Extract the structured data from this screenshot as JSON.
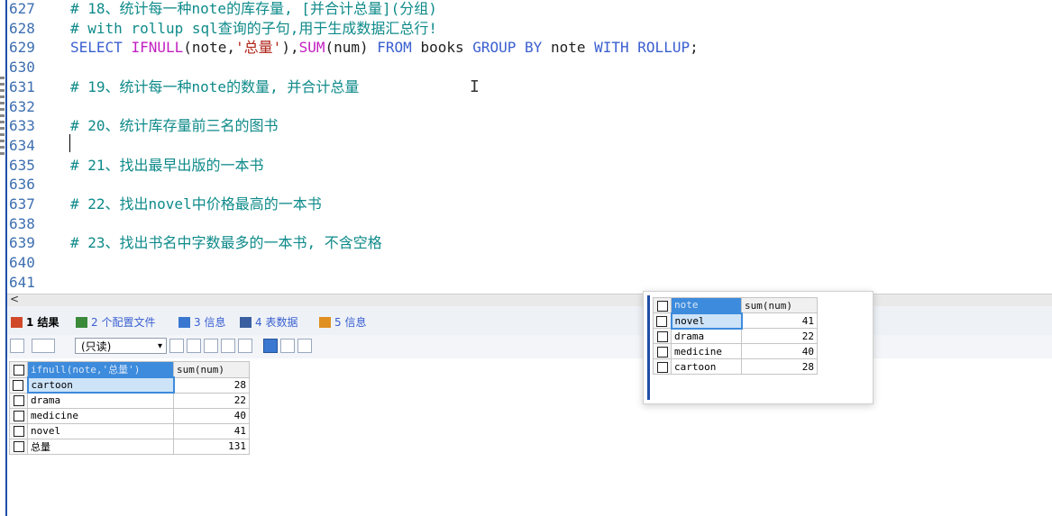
{
  "editor": {
    "lines": [
      {
        "num": "627",
        "parts": [
          {
            "t": "# 18、统计每一种note的库存量, [并合计总量](分组)",
            "c": "cm"
          }
        ]
      },
      {
        "num": "628",
        "parts": [
          {
            "t": "# with rollup sql查询的子句,用于生成数据汇总行!",
            "c": "cm"
          }
        ]
      },
      {
        "num": "629",
        "parts": [
          {
            "t": "SELECT ",
            "c": "kw"
          },
          {
            "t": "IFNULL",
            "c": "fn"
          },
          {
            "t": "(note,",
            "c": "pl"
          },
          {
            "t": "'总量'",
            "c": "str"
          },
          {
            "t": "),",
            "c": "pl"
          },
          {
            "t": "SUM",
            "c": "fn"
          },
          {
            "t": "(num) ",
            "c": "pl"
          },
          {
            "t": "FROM ",
            "c": "kw"
          },
          {
            "t": "books ",
            "c": "pl"
          },
          {
            "t": "GROUP BY ",
            "c": "kw"
          },
          {
            "t": "note ",
            "c": "pl"
          },
          {
            "t": "WITH ROLLUP",
            "c": "kw"
          },
          {
            "t": ";",
            "c": "pl"
          }
        ]
      },
      {
        "num": "630",
        "parts": []
      },
      {
        "num": "631",
        "parts": [
          {
            "t": "# 19、统计每一种note的数量, 并合计总量",
            "c": "cm"
          }
        ]
      },
      {
        "num": "632",
        "parts": []
      },
      {
        "num": "633",
        "parts": [
          {
            "t": "# 20、统计库存量前三名的图书",
            "c": "cm"
          }
        ]
      },
      {
        "num": "634",
        "parts": []
      },
      {
        "num": "635",
        "parts": [
          {
            "t": "# 21、找出最早出版的一本书",
            "c": "cm"
          }
        ]
      },
      {
        "num": "636",
        "parts": []
      },
      {
        "num": "637",
        "parts": [
          {
            "t": "# 22、找出novel中价格最高的一本书",
            "c": "cm"
          }
        ]
      },
      {
        "num": "638",
        "parts": []
      },
      {
        "num": "639",
        "parts": [
          {
            "t": "# 23、找出书名中字数最多的一本书, 不含空格",
            "c": "cm"
          }
        ]
      },
      {
        "num": "640",
        "parts": []
      },
      {
        "num": "641",
        "parts": []
      }
    ]
  },
  "scroll_left_label": "<",
  "tabs": [
    {
      "label": "1 结果",
      "active": true,
      "icon": "result-grid-icon",
      "color": "#d04a2a"
    },
    {
      "label": "2 个配置文件",
      "active": false,
      "icon": "profile-icon",
      "color": "#3a8a3a"
    },
    {
      "label": "3 信息",
      "active": false,
      "icon": "info-icon",
      "color": "#3a77d0"
    },
    {
      "label": "4 表数据",
      "active": false,
      "icon": "table-data-icon",
      "color": "#3a5fa0"
    },
    {
      "label": "5 信息",
      "active": false,
      "icon": "info-orange-icon",
      "color": "#e09020"
    }
  ],
  "toolbar": {
    "mode_select": "(只读)"
  },
  "result_grid": {
    "headers": [
      "ifnull(note,'总量')",
      "sum(num)"
    ],
    "rows": [
      {
        "note": "cartoon",
        "sum": "28"
      },
      {
        "note": "drama",
        "sum": "22"
      },
      {
        "note": "medicine",
        "sum": "40"
      },
      {
        "note": "novel",
        "sum": "41"
      },
      {
        "note": "总量",
        "sum": "131"
      }
    ]
  },
  "popup_grid": {
    "headers": [
      "note",
      "sum(num)"
    ],
    "rows": [
      {
        "note": "novel",
        "sum": "41"
      },
      {
        "note": "drama",
        "sum": "22"
      },
      {
        "note": "medicine",
        "sum": "40"
      },
      {
        "note": "cartoon",
        "sum": "28"
      }
    ]
  }
}
